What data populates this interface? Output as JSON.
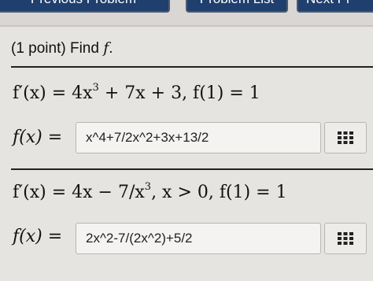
{
  "nav": {
    "prev_label": "Previous Problem",
    "list_label": "Problem List",
    "next_label": "Next Pr"
  },
  "header": {
    "points": "(1 point) Find",
    "fvar": "f",
    "period": "."
  },
  "problems": [
    {
      "equation_parts": {
        "lhs": "f′(x) = 4x",
        "exp": "3",
        "rest": " + 7x + 3,    f(1) = 1"
      },
      "answer_label": "f(x) =",
      "answer_value": "x^4+7/2x^2+3x+13/2"
    },
    {
      "equation_parts": {
        "lhs": "f′(x) = 4x − 7/x",
        "exp": "3",
        "rest": ",    x > 0,    f(1) = 1"
      },
      "answer_label": "f(x) =",
      "answer_value": "2x^2-7/(2x^2)+5/2"
    }
  ],
  "icons": {
    "grid": "grid-icon"
  },
  "colors": {
    "nav_button": "#1f3f6e",
    "panel": "#e6e4e1",
    "field": "#f4f3f1"
  }
}
